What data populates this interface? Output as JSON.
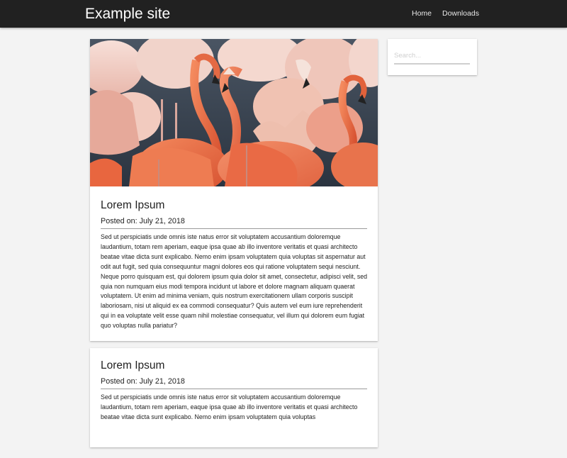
{
  "header": {
    "site_title": "Example site",
    "nav": [
      "Home",
      "Downloads"
    ],
    "background": "#212121"
  },
  "sidebar": {
    "search_placeholder": "Search..."
  },
  "posts": [
    {
      "title": "Lorem Ipsum",
      "date": "Posted on: July 21, 2018",
      "has_image": true,
      "image_subject": "flamingos",
      "body": "Sed ut perspiciatis unde omnis iste natus error sit voluptatem accusantium doloremque laudantium, totam rem aperiam, eaque ipsa quae ab illo inventore veritatis et quasi architecto beatae vitae dicta sunt explicabo. Nemo enim ipsam voluptatem quia voluptas sit aspernatur aut odit aut fugit, sed quia consequuntur magni dolores eos qui ratione voluptatem sequi nesciunt. Neque porro quisquam est, qui dolorem ipsum quia dolor sit amet, consectetur, adipisci velit, sed quia non numquam eius modi tempora incidunt ut labore et dolore magnam aliquam quaerat voluptatem. Ut enim ad minima veniam, quis nostrum exercitationem ullam corporis suscipit laboriosam, nisi ut aliquid ex ea commodi consequatur? Quis autem vel eum iure reprehenderit qui in ea voluptate velit esse quam nihil molestiae consequatur, vel illum qui dolorem eum fugiat quo voluptas nulla pariatur?"
    },
    {
      "title": "Lorem Ipsum",
      "date": "Posted on: July 21, 2018",
      "has_image": false,
      "body": "Sed ut perspiciatis unde omnis iste natus error sit voluptatem accusantium doloremque laudantium, totam rem aperiam, eaque ipsa quae ab illo inventore veritatis et quasi architecto beatae vitae dicta sunt explicabo. Nemo enim ipsam voluptatem quia voluptas"
    }
  ]
}
